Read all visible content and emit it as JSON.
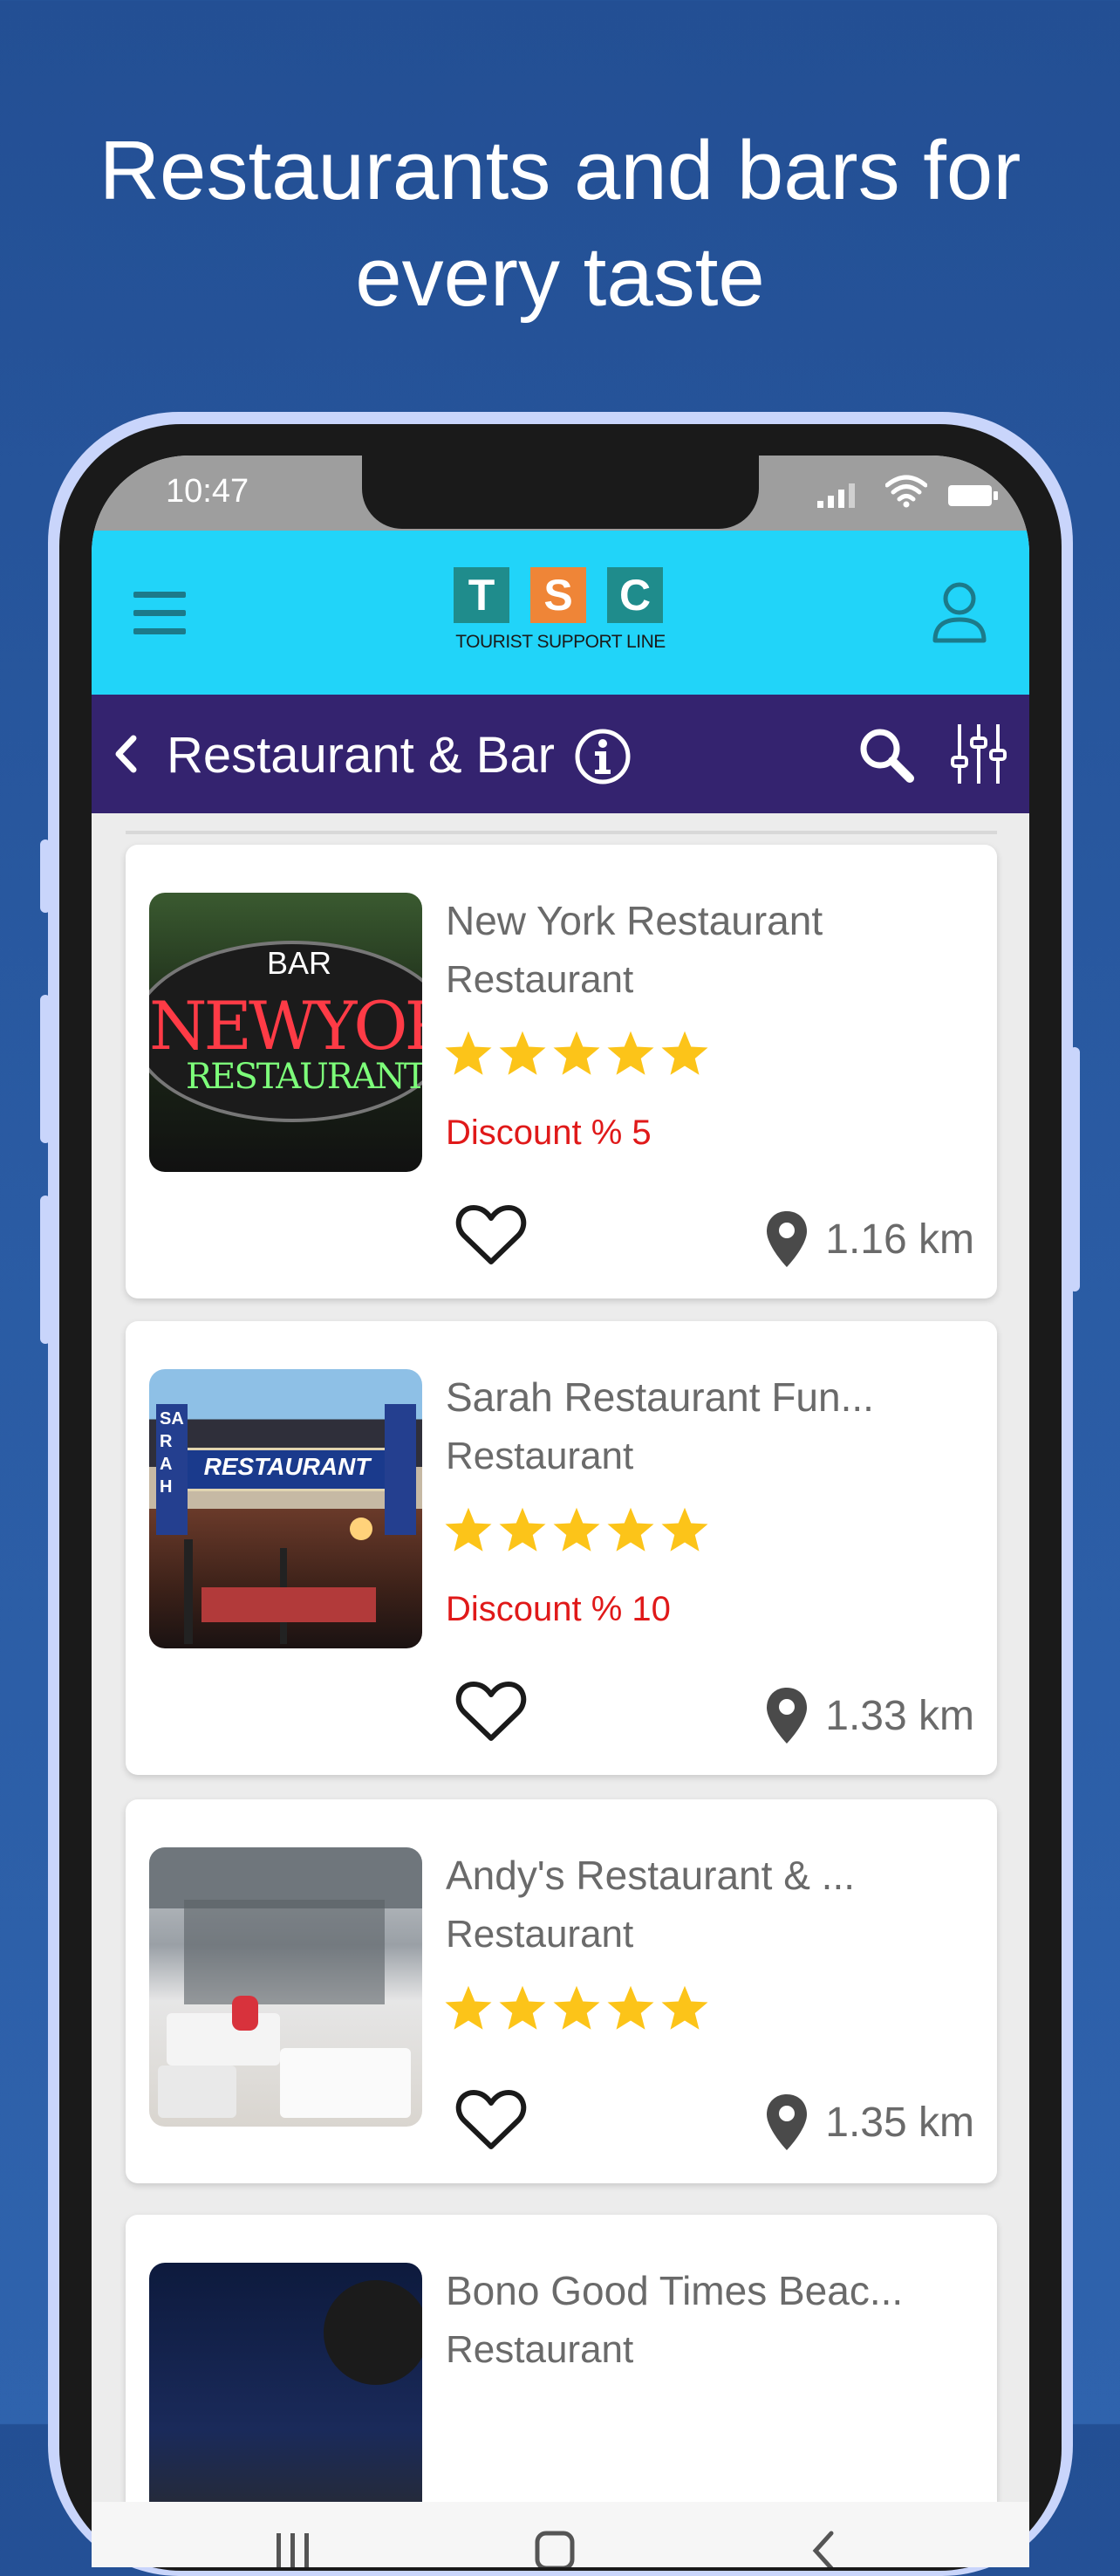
{
  "headline": {
    "line1": "Restaurants and bars for",
    "line2": "every taste"
  },
  "status_bar": {
    "time": "10:47"
  },
  "app_bar": {
    "logo_letters": [
      "T",
      "S",
      "C"
    ],
    "logo_subtitle": "TOURIST SUPPORT LINE",
    "menu_icon": "hamburger-icon",
    "profile_icon": "user-icon"
  },
  "sub_bar": {
    "title": "Restaurant & Bar",
    "back_icon": "chevron-left-icon",
    "info_icon": "info-icon",
    "search_icon": "search-icon",
    "filter_icon": "sliders-icon"
  },
  "listings": [
    {
      "name": "New York Restaurant",
      "category": "Restaurant",
      "rating": 5,
      "discount": "Discount % 5",
      "distance": "1.16 km",
      "image_text_top": "BAR",
      "image_text_main": "NEWYOR",
      "image_text_sub": "RESTAURANT"
    },
    {
      "name": "Sarah Restaurant Fun...",
      "category": "Restaurant",
      "rating": 5,
      "discount": "Discount % 10",
      "distance": "1.33 km",
      "image_text_main": "RESTAURANT",
      "image_text_side": "SARAH"
    },
    {
      "name": "Andy's Restaurant & ...",
      "category": "Restaurant",
      "rating": 5,
      "discount": "",
      "distance": "1.35 km"
    },
    {
      "name": "Bono Good Times Beac...",
      "category": "Restaurant"
    }
  ],
  "colors": {
    "background": "#2a5ba3",
    "app_bar": "#21d4f9",
    "sub_bar": "#34236f",
    "star": "#fcc419",
    "discount": "#e01919",
    "logo_teal": "#1f8c8c",
    "logo_orange": "#ef8537"
  }
}
